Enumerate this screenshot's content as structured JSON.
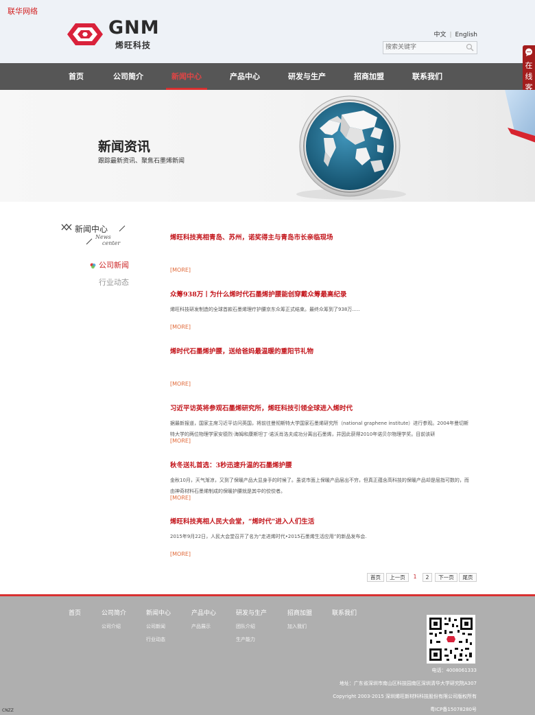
{
  "header": {
    "corner_brand": "联华网络",
    "logo_text": "GNM",
    "logo_sub": "烯旺科技",
    "lang_cn": "中文",
    "lang_en": "English",
    "search_placeholder": "搜索关键字"
  },
  "nav": [
    "首页",
    "公司简介",
    "新闻中心",
    "产品中心",
    "研发与生产",
    "招商加盟",
    "联系我们"
  ],
  "nav_active": "新闻中心",
  "service_tab": {
    "label": "在线客服"
  },
  "banner": {
    "title": "新闻资讯",
    "subtitle": "跟踪最新资讯、聚焦石墨烯新闻"
  },
  "sidebar": {
    "title": "新闻中心",
    "title_en_1": "News",
    "title_en_2": "center",
    "items": [
      {
        "label": "公司新闻",
        "active": true
      },
      {
        "label": "行业动态",
        "active": false
      }
    ]
  },
  "news": [
    {
      "title": "烯旺科技亮相青岛、苏州，诺奖得主与青岛市长亲临现场",
      "summary": "",
      "more": "[MORE]"
    },
    {
      "title": "众筹938万丨为什么烯时代石墨烯护腰能创穿戴众筹最高纪录",
      "summary": "烯旺科技研发制造的全球首款石墨烯理疗护腰京东众筹正式结束。最终众筹到了938万.....",
      "more": "[MORE]"
    },
    {
      "title": "烯时代石墨烯护腰，送给爸妈最温暖的重阳节礼物",
      "summary": "",
      "more": "[MORE]"
    },
    {
      "title": "习近平访英将参观石墨烯研究所，烯旺科技引领全球进入烯时代",
      "summary": "据最新报道，国家主席习近平访问英国，将前往曼彻斯特大学国家石墨烯研究所（national graphene institute）进行参观。2004年曼切斯特大学的两位物理学家安德烈·海姆和康斯坦丁·诺沃肖洛夫成功分离出石墨烯，并因此获得2010年诺贝尔物理学奖。目前该研",
      "more": "[MORE]"
    },
    {
      "title": "秋冬送礼首选：3秒迅速升温的石墨烯护腰",
      "summary": "金秋10月，天气渐凉，又到了保暖产品大显身手的时候了。虽说市面上保暖产品层出不穷，但真正蕴含高科技的保暖产品却是屈指可数的，而由神奇材料石墨烯制成的保暖护腰就是其中的佼佼者。",
      "more": "[MORE]"
    },
    {
      "title": "烯旺科技亮相人民大会堂，“烯时代”进入人们生活",
      "summary": "2015年9月22日，人民大会堂召开了名为“走进烯时代•2015石墨烯生活应用”的新品发布会.",
      "more": "[MORE]"
    }
  ],
  "pagination": {
    "first": "首页",
    "prev": "上一页",
    "pages": [
      "1",
      "2"
    ],
    "current": "1",
    "next": "下一页",
    "last": "尾页"
  },
  "footer": {
    "columns": [
      {
        "title": "首页",
        "links": []
      },
      {
        "title": "公司简介",
        "links": [
          "公司介绍"
        ]
      },
      {
        "title": "新闻中心",
        "links": [
          "公司新闻",
          "行业动态"
        ]
      },
      {
        "title": "产品中心",
        "links": [
          "产品展示"
        ]
      },
      {
        "title": "研发与生产",
        "links": [
          "团队介绍",
          "生产能力"
        ]
      },
      {
        "title": "招商加盟",
        "links": [
          "加入我们"
        ]
      },
      {
        "title": "联系我们",
        "links": []
      }
    ],
    "phone": "电话：4008061333",
    "address": "地址：广东省深圳市南山区科技园南区深圳清华大学研究院A307",
    "copyright": "Copyright 2003-2015 深圳烯旺新材料科技股份有限公司版权所有",
    "icp": "粤ICP备15078280号",
    "cnzz": "CNZZ"
  },
  "colors": {
    "brand_red": "#c3161c",
    "nav_bg": "#565656",
    "footer_bg": "#afafaf",
    "more_orange": "#e06a3a"
  }
}
